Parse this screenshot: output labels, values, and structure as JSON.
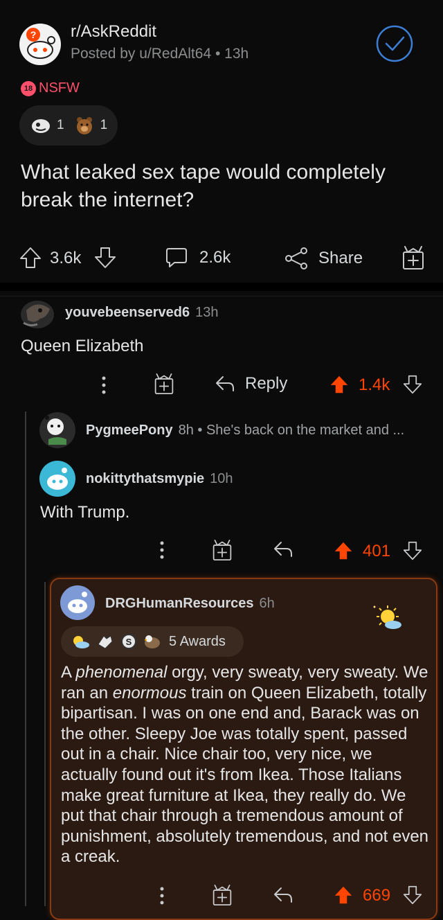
{
  "post": {
    "subreddit": "r/AskReddit",
    "posted_by": "Posted by u/RedAlt64 • 13h",
    "nsfw_badge": "18",
    "nsfw_label": "NSFW",
    "awards": [
      {
        "icon": "silver-award-icon",
        "count": "1"
      },
      {
        "icon": "bear-award-icon",
        "count": "1"
      }
    ],
    "title": "What leaked sex tape would completely break the internet?",
    "upvotes": "3.6k",
    "comments": "2.6k",
    "share_label": "Share"
  },
  "comments": [
    {
      "author": "youvebeenserved6",
      "age": "13h",
      "body": "Queen Elizabeth",
      "reply_label": "Reply",
      "score": "1.4k"
    },
    {
      "author": "PygmeePony",
      "meta": "8h • She's back on the market and ..."
    },
    {
      "author": "nokittythatsmypie",
      "age": "10h",
      "body": "With Trump.",
      "score": "401"
    },
    {
      "author": "DRGHumanResources",
      "age": "6h",
      "awards_label": "5 Awards",
      "body_parts": [
        {
          "text": "A ",
          "italic": false
        },
        {
          "text": "phenomenal",
          "italic": true
        },
        {
          "text": " orgy, very sweaty, very sweaty. We ran an ",
          "italic": false
        },
        {
          "text": "enormous",
          "italic": true
        },
        {
          "text": " train on Queen Elizabeth, totally bipartisan. I was on one end and, Barack was on the other. Sleepy Joe was totally spent, passed out in a chair. Nice chair too, very nice, we actually found out it's from Ikea. Those Italians make great furniture at Ikea, they really do. We put that chair through a tremendous amount of punishment, absolutely tremendous, and not even a creak.",
          "italic": false
        }
      ],
      "score": "669"
    }
  ],
  "colors": {
    "accent": "#ff4500",
    "highlight_border": "#8a3a12",
    "highlight_bg": "#2a1a12",
    "verified": "#3d7fd6"
  }
}
